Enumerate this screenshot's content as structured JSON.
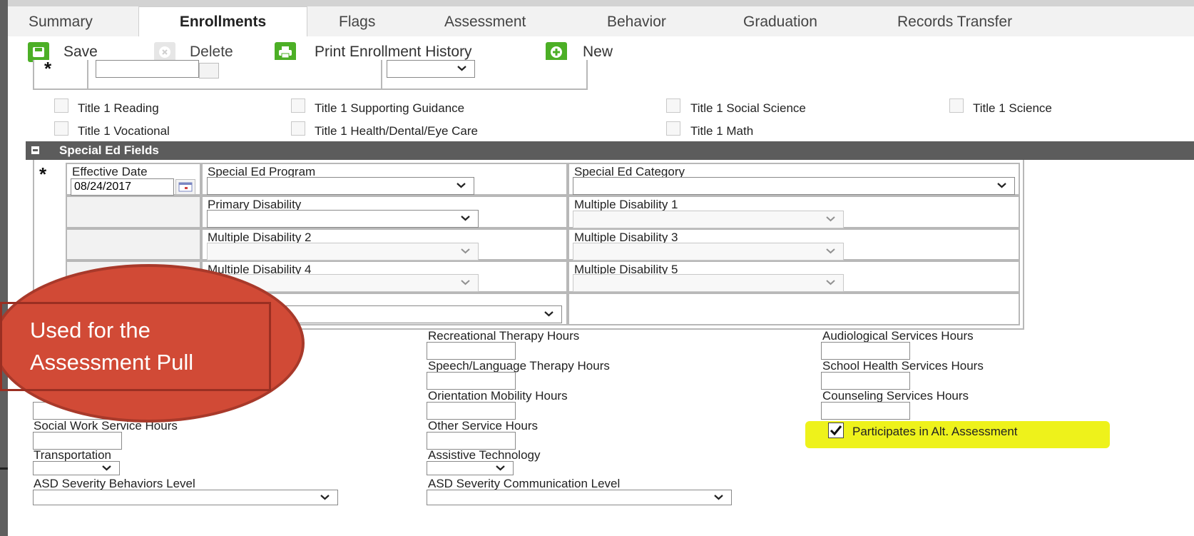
{
  "tabs": [
    "Summary",
    "Enrollments",
    "Flags",
    "Assessment",
    "Behavior",
    "Graduation",
    "Records Transfer"
  ],
  "active_tab": "Enrollments",
  "toolbar": {
    "save": "Save",
    "delete": "Delete",
    "print": "Print Enrollment History",
    "new": "New"
  },
  "title1_checkboxes": [
    "Title 1 Reading",
    "Title 1 Supporting Guidance",
    "Title 1 Social Science",
    "Title 1 Science",
    "Title 1 Vocational",
    "Title 1 Health/Dental/Eye Care",
    "Title 1 Math"
  ],
  "special_ed": {
    "section_title": "Special Ed Fields",
    "effective_date_label": "Effective Date",
    "effective_date_value": "08/24/2017",
    "program_label": "Special Ed Program",
    "category_label": "Special Ed Category",
    "primary_disability_label": "Primary Disability",
    "multiple_disability_1_label": "Multiple Disability 1",
    "multiple_disability_2_label": "Multiple Disability 2",
    "multiple_disability_3_label": "Multiple Disability 3",
    "multiple_disability_4_label": "Multiple Disability 4",
    "multiple_disability_5_label": "Multiple Disability 5"
  },
  "services": {
    "recreational": "Recreational Therapy Hours",
    "audiological": "Audiological Services Hours",
    "speech": "Speech/Language Therapy Hours",
    "school_health": "School Health Services Hours",
    "orientation": "Orientation Mobility Hours",
    "counseling": "Counseling Services Hours",
    "social_work": "Social Work Service Hours",
    "other": "Other Service Hours",
    "transportation": "Transportation",
    "assistive": "Assistive Technology",
    "asd_behaviors": "ASD Severity Behaviors Level",
    "asd_communication": "ASD Severity Communication Level",
    "alt_assessment": "Participates in Alt. Assessment",
    "alt_assessment_checked": true
  },
  "callout": {
    "line1": "Used for the",
    "line2": "Assessment Pull"
  },
  "colors": {
    "toolbar_green": "#4caf26",
    "section_header": "#5c5c5c",
    "highlight": "#eef21b",
    "callout": "#d14a36"
  }
}
